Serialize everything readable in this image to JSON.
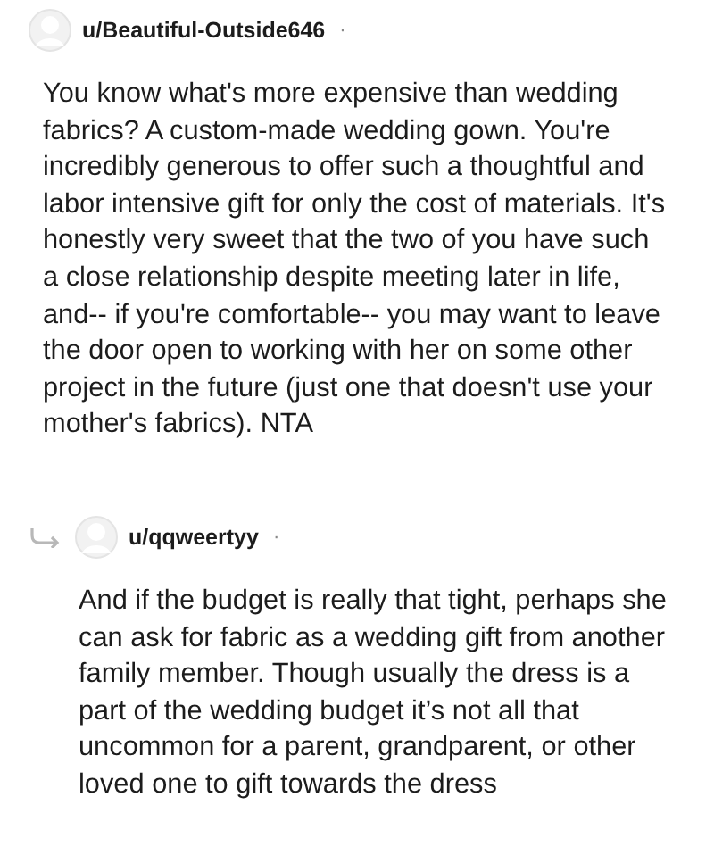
{
  "comments": [
    {
      "kind": "top",
      "author": "u/Beautiful-Outside646",
      "separator": "·",
      "body": "You know what's more expensive than wedding fabrics? A custom-made wedding gown. You're incredibly generous to offer such a thoughtful and labor intensive gift for only the cost of materials. It's honestly very sweet that the two of you have such a close relationship despite meeting later in life, and-- if you're comfortable-- you may want to leave the door open to working with her on some other project in the future (just one that doesn't use your mother's fabrics). NTA"
    },
    {
      "kind": "reply",
      "author": "u/qqweertyy",
      "separator": "·",
      "body": "And if the budget is really that tight, perhaps she can ask for fabric as a wedding gift from another family member. Though usually the dress is a part of the wedding budget it’s not all that uncommon for a parent, grandparent, or other loved one to gift towards the dress"
    }
  ]
}
